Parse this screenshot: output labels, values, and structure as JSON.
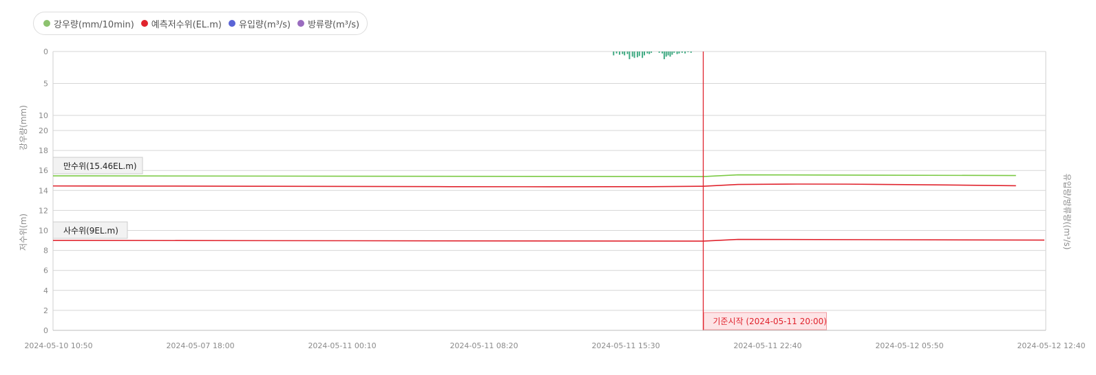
{
  "legend": {
    "items": [
      {
        "label": "강우량(mm/10min)",
        "color": "#8dc26f"
      },
      {
        "label": "예측저수위(EL.m)",
        "color": "#e0232d"
      },
      {
        "label": "유입량(m³/s)",
        "color": "#5a64d6"
      },
      {
        "label": "방류량(m³/s)",
        "color": "#9a6cbf"
      }
    ]
  },
  "chart_data": {
    "type": "line",
    "rain_axis": {
      "title": "강우량(mm)",
      "ticks": [
        "0",
        "5",
        "10"
      ],
      "range": [
        0,
        10
      ],
      "inverted": true
    },
    "level_axis": {
      "title": "저수위(m)",
      "ticks": [
        "0",
        "2",
        "4",
        "6",
        "8",
        "10",
        "12",
        "14",
        "16",
        "18",
        "20"
      ],
      "range": [
        0,
        20
      ]
    },
    "flow_axis": {
      "title": "유입량/방류량((m³/s)"
    },
    "x_ticks": [
      "2024-05-10 10:50",
      "2024-05-07 18:00",
      "2024-05-11 00:10",
      "2024-05-11 08:20",
      "2024-05-11 15:30",
      "2024-05-11 22:40",
      "2024-05-12 05:50",
      "2024-05-12 12:40"
    ],
    "reference_lines": [
      {
        "label": "만수위(15.46EL.m)",
        "value": 15.46,
        "color": "#7ac943"
      },
      {
        "label": "사수위(9EL.m)",
        "value": 9.0,
        "color": "#e0232d"
      }
    ],
    "now_marker": {
      "label": "기준시작 (2024-05-11 20:00)",
      "x_fraction": 0.655,
      "color": "#e0232d"
    },
    "series": [
      {
        "name": "예측저수위(EL.m)",
        "color": "#e0232d",
        "x_fraction": [
          0,
          0.1,
          0.2,
          0.3,
          0.4,
          0.5,
          0.6,
          0.655,
          0.69,
          0.75,
          0.8,
          0.9,
          0.97
        ],
        "values": [
          14.45,
          14.44,
          14.42,
          14.4,
          14.38,
          14.37,
          14.38,
          14.42,
          14.6,
          14.64,
          14.63,
          14.55,
          14.47
        ]
      }
    ],
    "rainfall": {
      "name": "강우량(mm/10min)",
      "color": "#3fa982",
      "x_fraction": [
        0.564,
        0.567,
        0.57,
        0.573,
        0.575,
        0.578,
        0.58,
        0.583,
        0.585,
        0.588,
        0.59,
        0.593,
        0.595,
        0.598,
        0.6,
        0.602,
        0.61,
        0.613,
        0.615,
        0.617,
        0.619,
        0.621,
        0.623,
        0.625,
        0.628,
        0.63,
        0.633,
        0.636,
        0.639,
        0.642
      ],
      "values": [
        0.6,
        0.3,
        0.5,
        0.4,
        0.6,
        0.4,
        1.2,
        0.8,
        1.0,
        0.9,
        0.7,
        1.0,
        0.6,
        0.3,
        0.4,
        0.2,
        0.2,
        0.3,
        1.2,
        0.8,
        0.6,
        0.8,
        0.5,
        0.2,
        0.4,
        0.3,
        0.2,
        0.3,
        0.1,
        0.2
      ]
    }
  }
}
